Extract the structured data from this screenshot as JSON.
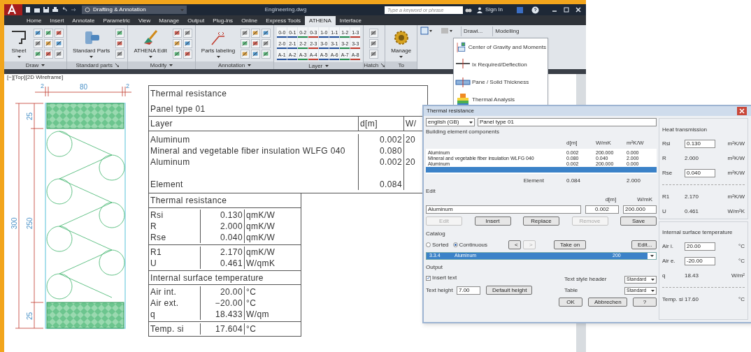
{
  "title_bar": {
    "workspace": "Drafting & Annotation",
    "title": "Engineering.dwg",
    "search_placeholder": "Type a keyword or phrase",
    "sign_in": "Sign In"
  },
  "menu_tabs": [
    {
      "label": "Home",
      "selected": false
    },
    {
      "label": "Insert",
      "selected": false
    },
    {
      "label": "Annotate",
      "selected": false
    },
    {
      "label": "Parametric",
      "selected": false
    },
    {
      "label": "View",
      "selected": false
    },
    {
      "label": "Manage",
      "selected": false
    },
    {
      "label": "Output",
      "selected": false
    },
    {
      "label": "Plug-ins",
      "selected": false
    },
    {
      "label": "Online",
      "selected": false
    },
    {
      "label": "Express Tools",
      "selected": false
    },
    {
      "label": "ATHENA",
      "selected": true
    },
    {
      "label": "Interface",
      "selected": false
    }
  ],
  "ribbon": {
    "panels": [
      {
        "kind": "tools",
        "label": "Draw",
        "menu_caret": true,
        "button": "Sheet"
      },
      {
        "kind": "tools",
        "label": "Standard parts",
        "dialog_launcher": true,
        "button": "Standard Parts"
      },
      {
        "kind": "tools",
        "label": "Modify",
        "menu_caret": true,
        "button": "ATHENA Edit"
      },
      {
        "kind": "tools",
        "label": "Annotation",
        "menu_caret": true,
        "button": "Parts labeling"
      },
      {
        "kind": "layers",
        "label": "Layer",
        "menu_caret": true,
        "layers": [
          "0-0",
          "0-1",
          "0-2",
          "0-3",
          "1-0",
          "1-1",
          "1-2",
          "1-3",
          "2-0",
          "2-1",
          "2-2",
          "2-3",
          "3-0",
          "3-1",
          "3-2",
          "3-3",
          "A-1",
          "A-2",
          "A-3",
          "A-4",
          "A-5",
          "A-6",
          "A-7",
          "A-8"
        ]
      },
      {
        "kind": "icons",
        "label": "Hatch",
        "dialog_launcher": true
      },
      {
        "kind": "tools",
        "label": "To",
        "button": "Manage"
      }
    ],
    "buttons": [
      "Drawi...",
      "Modelling"
    ]
  },
  "tool_menu": [
    "Center of Gravity and Moments",
    "Ix Required/Deflection",
    "Pane / Solid Thickness",
    "Thermal Analysis"
  ],
  "viewport": {
    "label": "[−][Top][2D Wireframe]"
  },
  "drawing": {
    "top_dims": [
      "2",
      "80",
      "2"
    ],
    "overall_dim": "300",
    "side_dims": [
      "25",
      "250",
      "25"
    ]
  },
  "cad_table": {
    "title": "Thermal resistance",
    "subtitle": "Panel type 01",
    "header": [
      "Layer",
      "d[m]",
      "W/"
    ],
    "layers": [
      {
        "name": "Aluminum",
        "d": "0.002",
        "col3": "20"
      },
      {
        "name": "Mineral and vegetable fiber insulation WLFG 040",
        "d": "0.080"
      },
      {
        "name": "Aluminum",
        "d": "0.002",
        "col3": "20"
      }
    ],
    "element": {
      "label": "Element",
      "d": "0.084"
    },
    "sections": [
      {
        "title": "Thermal resistance",
        "groups": [
          [
            {
              "label": "Rsi",
              "value": "0.130",
              "unit": "qmK/W"
            },
            {
              "label": "R",
              "value": "2.000",
              "unit": "qmK/W"
            },
            {
              "label": "Rse",
              "value": "0.040",
              "unit": "qmK/W"
            }
          ],
          [
            {
              "label": "R1",
              "value": "2.170",
              "unit": "qmK/W"
            },
            {
              "label": "U",
              "value": "0.461",
              "unit": "W/qmK"
            }
          ]
        ]
      },
      {
        "title": "Internal surface temperature",
        "groups": [
          [
            {
              "label": "Air int.",
              "value": "20.00",
              "unit": "°C"
            },
            {
              "label": "Air ext.",
              "value": "−20.00",
              "unit": "°C"
            },
            {
              "label": "q",
              "value": "18.433",
              "unit": "W/qm"
            }
          ],
          [
            {
              "label": "Temp. si",
              "value": "17.604",
              "unit": "°C"
            }
          ]
        ]
      }
    ]
  },
  "dialog": {
    "title": "Thermal resistance",
    "language": "english (GB)",
    "name_value": "Panel type 01",
    "components": {
      "label": "Building element components",
      "columns": [
        "d[m]",
        "W/mK",
        "m²K/W"
      ],
      "rows": [
        {
          "name": "Aluminum",
          "values": [
            "0.002",
            "200.000",
            "0.000"
          ],
          "selected": false
        },
        {
          "name": "Mineral and vegetable fiber insulation WLFG 040",
          "values": [
            "0.080",
            "0.040",
            "2.000"
          ],
          "selected": false
        },
        {
          "name": "Aluminum",
          "values": [
            "0.002",
            "200.000",
            "0.000"
          ],
          "selected": false
        }
      ],
      "blank_row": {
        "selected": true
      },
      "element": {
        "label": "Element",
        "d": "0.084",
        "r": "2.000"
      }
    },
    "edit": {
      "label": "Edit",
      "columns": [
        "d[m]",
        "W/mK"
      ],
      "name": "Aluminum",
      "d": "0.002",
      "lambda": "200.000",
      "buttons": [
        {
          "label": "Edit",
          "disabled": true
        },
        {
          "label": "Insert",
          "disabled": false
        },
        {
          "label": "Replace",
          "disabled": false
        },
        {
          "label": "Remove",
          "disabled": true
        },
        {
          "label": "Save",
          "disabled": false
        }
      ]
    },
    "catalog": {
      "label": "Catalog",
      "options": [
        {
          "label": "Sorted",
          "selected": false
        },
        {
          "label": "Continuous",
          "selected": true
        }
      ],
      "nav": [
        {
          "label": "<",
          "disabled": false
        },
        {
          "label": ">",
          "disabled": true
        }
      ],
      "take_on": "Take on",
      "edit": "Edit...",
      "entry": {
        "code": "3.3.4",
        "name": "Aluminum",
        "value": "200"
      }
    },
    "output": {
      "label": "Output",
      "insert_text": {
        "label": "Insert text",
        "checked": true
      },
      "text_height": {
        "label": "Text height",
        "value": "7.00"
      },
      "default_height": "Default height",
      "header_style": {
        "label": "Text style header",
        "value": "Standard"
      },
      "table_style": {
        "label": "Table",
        "value": "Standard"
      }
    },
    "footer_buttons": [
      "OK",
      "Abbrechen",
      "?"
    ],
    "heat": {
      "label": "Heat transmission",
      "rows": [
        {
          "kind": "input",
          "label": "Rsi",
          "value": "0.130",
          "unit": "m²K/W"
        },
        {
          "kind": "text",
          "label": "R",
          "value": "2.000",
          "unit": "m²K/W"
        },
        {
          "kind": "input",
          "label": "Rse",
          "value": "0.040",
          "unit": "m²K/W"
        },
        {
          "kind": "separator"
        },
        {
          "kind": "text",
          "label": "R1",
          "value": "2.170",
          "unit": "m²K/W"
        },
        {
          "kind": "text",
          "label": "U",
          "value": "0.461",
          "unit": "W/m²K"
        }
      ]
    },
    "surface": {
      "label": "Internal surface temperature",
      "rows": [
        {
          "kind": "input",
          "label": "Air i.",
          "value": "20.00",
          "unit": "°C"
        },
        {
          "kind": "input",
          "label": "Air e.",
          "value": "-20.00",
          "unit": "°C"
        },
        {
          "kind": "text",
          "label": "q",
          "value": "18.43",
          "unit": "W/m²"
        },
        {
          "kind": "separator"
        },
        {
          "kind": "text",
          "label": "Temp. si",
          "value": "17.60",
          "unit": "°C"
        }
      ]
    }
  }
}
